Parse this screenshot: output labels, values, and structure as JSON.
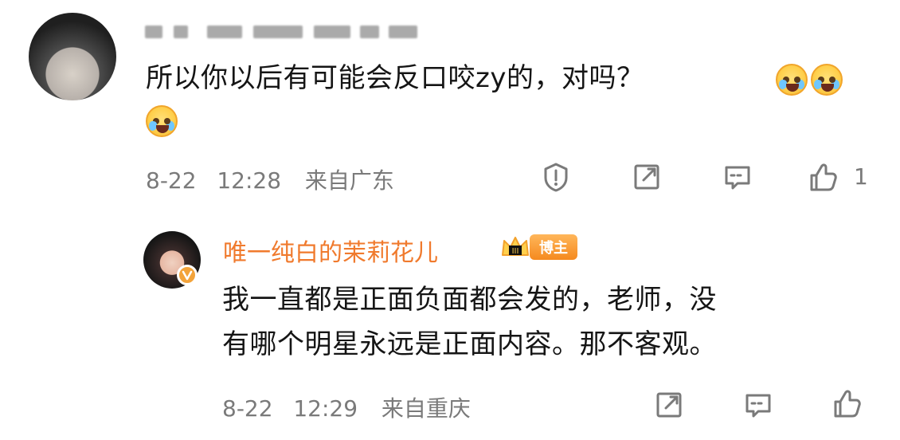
{
  "comment": {
    "text_line1": "所以你以后有可能会反口咬zy的，对吗？",
    "meta": {
      "date": "8-22",
      "time": "12:28",
      "location": "来自广东"
    },
    "actions": {
      "report_icon": "report-icon",
      "share_icon": "share-icon",
      "reply_icon": "reply-icon",
      "like_icon": "like-icon",
      "like_count": "1"
    },
    "emojis": [
      "crying-laughing-emoji",
      "crying-laughing-emoji",
      "crying-laughing-emoji"
    ]
  },
  "reply": {
    "author": "唯一纯白的茉莉花儿",
    "badge": "博主",
    "text_line1": "我一直都是正面负面都会发的，老师，没",
    "text_line2": "有哪个明星永远是正面内容。那不客观。",
    "meta": {
      "date": "8-22",
      "time": "12:29",
      "location": "来自重庆"
    },
    "actions": {
      "share_icon": "share-icon",
      "reply_icon": "reply-icon",
      "like_icon": "like-icon"
    }
  },
  "colors": {
    "text": "#151515",
    "meta": "#7a7a7a",
    "author": "#f07a2d",
    "badge_gradient_top": "#ffb65a",
    "badge_gradient_bottom": "#f58a1f",
    "vip": "#f3a33a"
  }
}
